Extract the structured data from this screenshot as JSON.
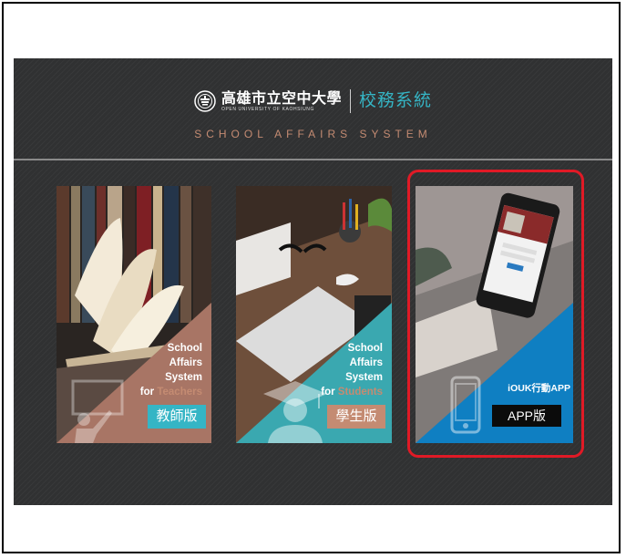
{
  "header": {
    "university_name": "高雄市立空中大學",
    "university_english": "OPEN UNIVERSITY OF KAOHSIUNG",
    "system_title": "校務系統",
    "system_english": "SCHOOL AFFAIRS SYSTEM"
  },
  "cards": [
    {
      "line1": "School",
      "line2": "Affairs",
      "line3": "System",
      "for_word": "for",
      "audience": "Teachers",
      "button_label": "教師版",
      "icon": "teacher-icon",
      "accent": "#a87565"
    },
    {
      "line1": "School",
      "line2": "Affairs",
      "line3": "System",
      "for_word": "for",
      "audience": "Students",
      "button_label": "學生版",
      "icon": "graduate-icon",
      "accent": "#3aa8b0"
    },
    {
      "app_title": "iOUK行動APP",
      "button_label": "APP版",
      "icon": "smartphone-icon",
      "accent": "#0f7fc2"
    }
  ],
  "highlight_color": "#e01a26"
}
